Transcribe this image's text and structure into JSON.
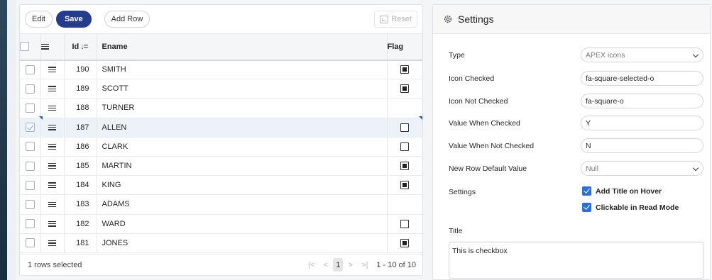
{
  "toolbar": {
    "edit_label": "Edit",
    "save_label": "Save",
    "add_row_label": "Add Row",
    "reset_label": "Reset"
  },
  "grid": {
    "columns": {
      "id": "Id",
      "ename": "Ename",
      "flag": "Flag"
    },
    "rows": [
      {
        "id": "190",
        "ename": "SMITH",
        "flag": "checked",
        "selected": false
      },
      {
        "id": "189",
        "ename": "SCOTT",
        "flag": "checked",
        "selected": false
      },
      {
        "id": "188",
        "ename": "TURNER",
        "flag": "none",
        "selected": false
      },
      {
        "id": "187",
        "ename": "ALLEN",
        "flag": "unchecked",
        "selected": true
      },
      {
        "id": "186",
        "ename": "CLARK",
        "flag": "unchecked",
        "selected": false
      },
      {
        "id": "185",
        "ename": "MARTIN",
        "flag": "checked",
        "selected": false
      },
      {
        "id": "184",
        "ename": "KING",
        "flag": "checked",
        "selected": false
      },
      {
        "id": "183",
        "ename": "ADAMS",
        "flag": "none",
        "selected": false
      },
      {
        "id": "182",
        "ename": "WARD",
        "flag": "unchecked",
        "selected": false
      },
      {
        "id": "181",
        "ename": "JONES",
        "flag": "checked",
        "selected": false
      }
    ],
    "footer": {
      "selection_status": "1 rows selected",
      "current_page": "1",
      "range": "1 - 10 of 10"
    }
  },
  "settings": {
    "title": "Settings",
    "type_label": "Type",
    "type_value": "APEX icons",
    "icon_checked_label": "Icon Checked",
    "icon_checked_value": "fa-square-selected-o",
    "icon_not_checked_label": "Icon Not Checked",
    "icon_not_checked_value": "fa-square-o",
    "value_checked_label": "Value When Checked",
    "value_checked_value": "Y",
    "value_not_checked_label": "Value When Not Checked",
    "value_not_checked_value": "N",
    "new_row_default_label": "New Row Default Value",
    "new_row_default_value": "Null",
    "settings_label": "Settings",
    "add_title_label": "Add Title on Hover",
    "clickable_label": "Clickable in Read Mode",
    "title_label": "Title",
    "title_value": "This is checkbox"
  },
  "colors": {
    "primary": "#253c8c",
    "checkbox_blue": "#2e6fd1",
    "selected_row": "#edf2f8"
  }
}
